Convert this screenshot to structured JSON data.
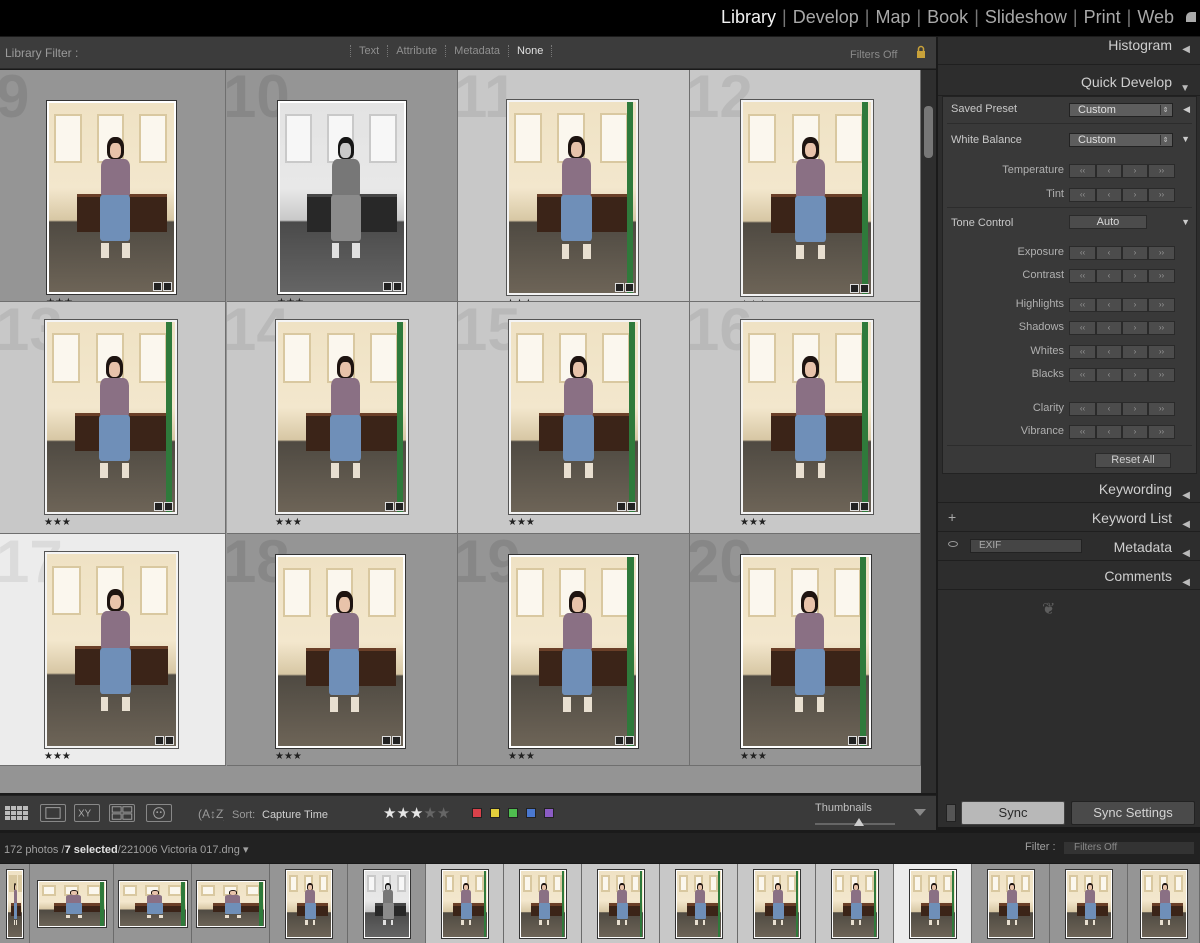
{
  "modules": {
    "items": [
      "Library",
      "Develop",
      "Map",
      "Book",
      "Slideshow",
      "Print",
      "Web"
    ],
    "active": "Library"
  },
  "filter_bar": {
    "title": "Library Filter :",
    "tabs": [
      "Text",
      "Attribute",
      "Metadata",
      "None"
    ],
    "active_tab": "None",
    "filters_off": "Filters Off"
  },
  "grid": {
    "cells": [
      {
        "num": "9",
        "rating": "★★★",
        "state": "normal",
        "bw": false
      },
      {
        "num": "10",
        "rating": "★★★",
        "state": "normal",
        "bw": true
      },
      {
        "num": "11",
        "rating": "★★★",
        "state": "selected",
        "bw": false
      },
      {
        "num": "12",
        "rating": "★★★",
        "state": "selected",
        "bw": false
      },
      {
        "num": "13",
        "rating": "★★★",
        "state": "selected",
        "bw": false
      },
      {
        "num": "14",
        "rating": "★★★",
        "state": "selected",
        "bw": false
      },
      {
        "num": "15",
        "rating": "★★★",
        "state": "selected",
        "bw": false
      },
      {
        "num": "16",
        "rating": "★★★",
        "state": "selected",
        "bw": false
      },
      {
        "num": "17",
        "rating": "★★★",
        "state": "primary",
        "bw": false
      },
      {
        "num": "18",
        "rating": "★★★",
        "state": "normal",
        "bw": false
      },
      {
        "num": "19",
        "rating": "★★★",
        "state": "normal",
        "bw": false
      },
      {
        "num": "20",
        "rating": "★★★",
        "state": "normal",
        "bw": false
      }
    ]
  },
  "toolbar": {
    "sort_label": "Sort:",
    "sort_value": "Capture Time",
    "stars_filled": 3,
    "stars_total": 5,
    "color_labels": [
      "#d9414a",
      "#e3cf3c",
      "#4fbe4f",
      "#4a78d0",
      "#8b5cc4"
    ],
    "thumbnails_label": "Thumbnails",
    "thumbnail_size": 0.55
  },
  "right_panel": {
    "histogram": "Histogram",
    "quick_develop": "Quick Develop",
    "saved_preset_label": "Saved Preset",
    "saved_preset_value": "Custom",
    "white_balance_label": "White Balance",
    "white_balance_value": "Custom",
    "wb_rows": [
      "Temperature",
      "Tint"
    ],
    "tone_control_label": "Tone Control",
    "auto_label": "Auto",
    "tone_rows_1": [
      "Exposure",
      "Contrast"
    ],
    "tone_rows_2": [
      "Highlights",
      "Shadows",
      "Whites",
      "Blacks"
    ],
    "tone_rows_3": [
      "Clarity",
      "Vibrance"
    ],
    "reset_all": "Reset All",
    "keywording": "Keywording",
    "keyword_list": "Keyword List",
    "metadata": "Metadata",
    "metadata_preset": "EXIF",
    "comments": "Comments",
    "sync": "Sync",
    "sync_settings": "Sync Settings"
  },
  "filmstrip": {
    "count_prefix": "172 photos /",
    "selected": "7 selected",
    "file": "/221006 Victoria 017.dng",
    "filter_label": "Filter :",
    "filter_value": "Filters Off"
  },
  "colors": {
    "background": "#1a1a1a",
    "panel": "#2d2d2d",
    "grid_cell": "#959595",
    "selected_cell": "#c8c8c8",
    "primary_cell": "#ececec"
  }
}
